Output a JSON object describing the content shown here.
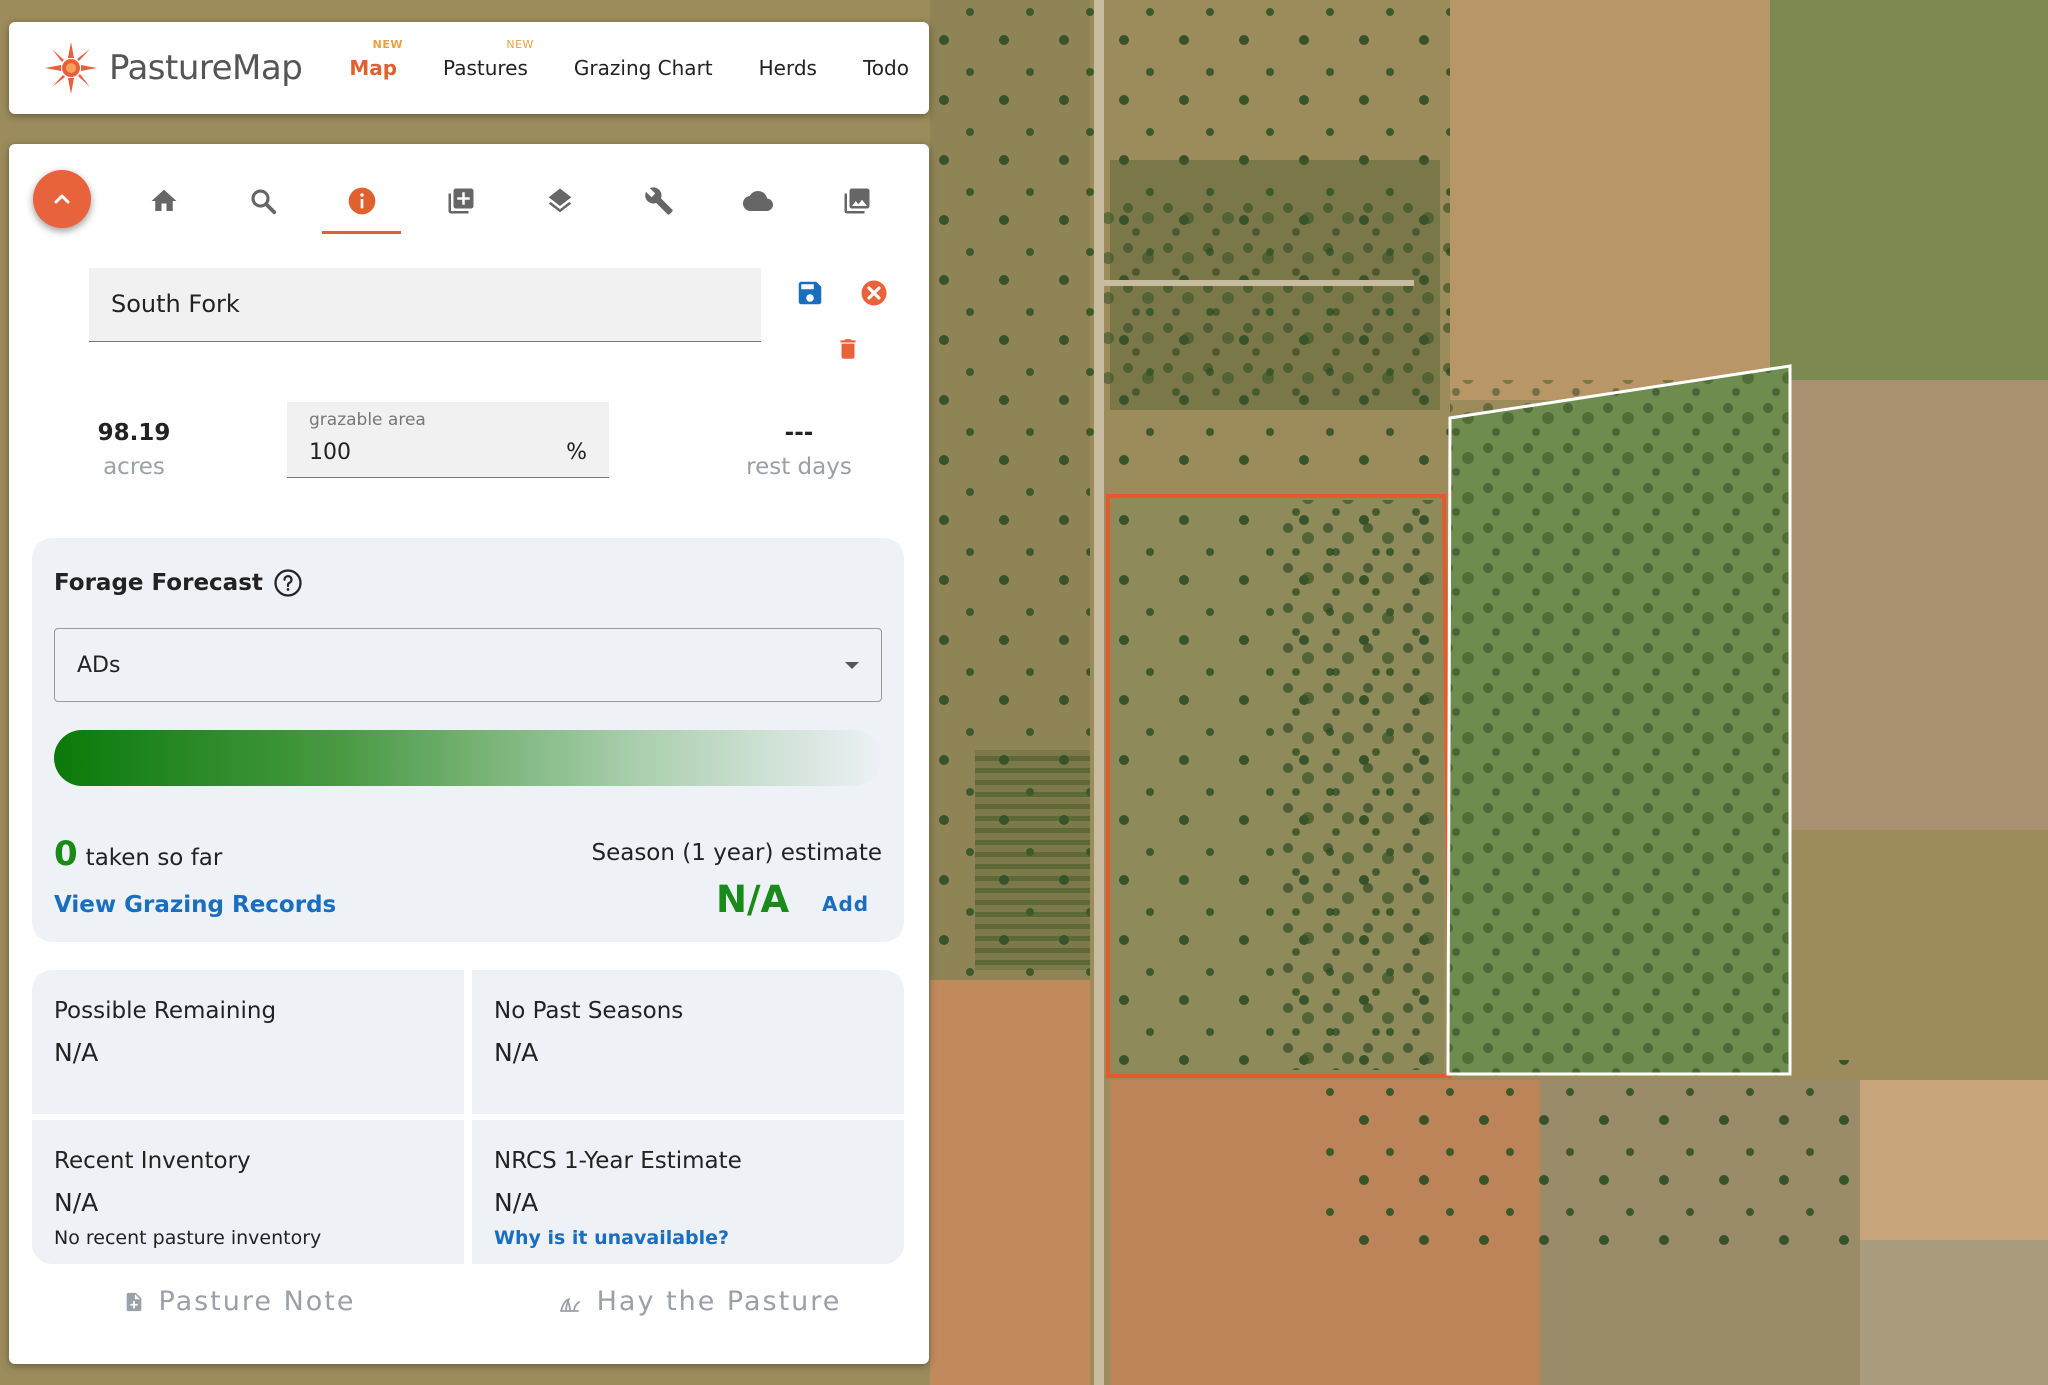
{
  "app": {
    "logo_text": "PastureMap",
    "brand_color": "#e06030"
  },
  "nav": {
    "items": [
      {
        "label": "Map",
        "badge": "NEW",
        "active": true
      },
      {
        "label": "Pastures",
        "badge": "NEW",
        "active": false
      },
      {
        "label": "Grazing Chart",
        "badge": "",
        "active": false
      },
      {
        "label": "Herds",
        "badge": "",
        "active": false
      },
      {
        "label": "Todo",
        "badge": "",
        "active": false
      }
    ]
  },
  "toolbar": {
    "icons": [
      "home-icon",
      "search-icon",
      "info-icon",
      "add-layer-icon",
      "layers-icon",
      "wrench-icon",
      "cloud-icon",
      "photos-icon"
    ],
    "active": "info-icon"
  },
  "pasture": {
    "name": "South Fork",
    "acres_value": "98.19",
    "acres_label": "acres",
    "grazable_label": "grazable area",
    "grazable_value": "100",
    "grazable_unit": "%",
    "rest_value": "---",
    "rest_label": "rest days"
  },
  "forecast": {
    "title": "Forage Forecast",
    "select_value": "ADs",
    "taken_value": "0",
    "taken_label": "taken so far",
    "view_records": "View Grazing Records",
    "season_label": "Season (1 year) estimate",
    "season_value": "N/A",
    "add_label": "Add"
  },
  "cards": {
    "possible_remaining": {
      "title": "Possible Remaining",
      "value": "N/A"
    },
    "past_seasons": {
      "title": "No Past Seasons",
      "value": "N/A"
    },
    "recent_inventory": {
      "title": "Recent Inventory",
      "value": "N/A",
      "note": "No recent pasture inventory"
    },
    "nrcs": {
      "title": "NRCS 1-Year Estimate",
      "value": "N/A",
      "link": "Why is it unavailable?"
    }
  },
  "actions": {
    "note": "Pasture Note",
    "hay": "Hay the Pasture"
  }
}
